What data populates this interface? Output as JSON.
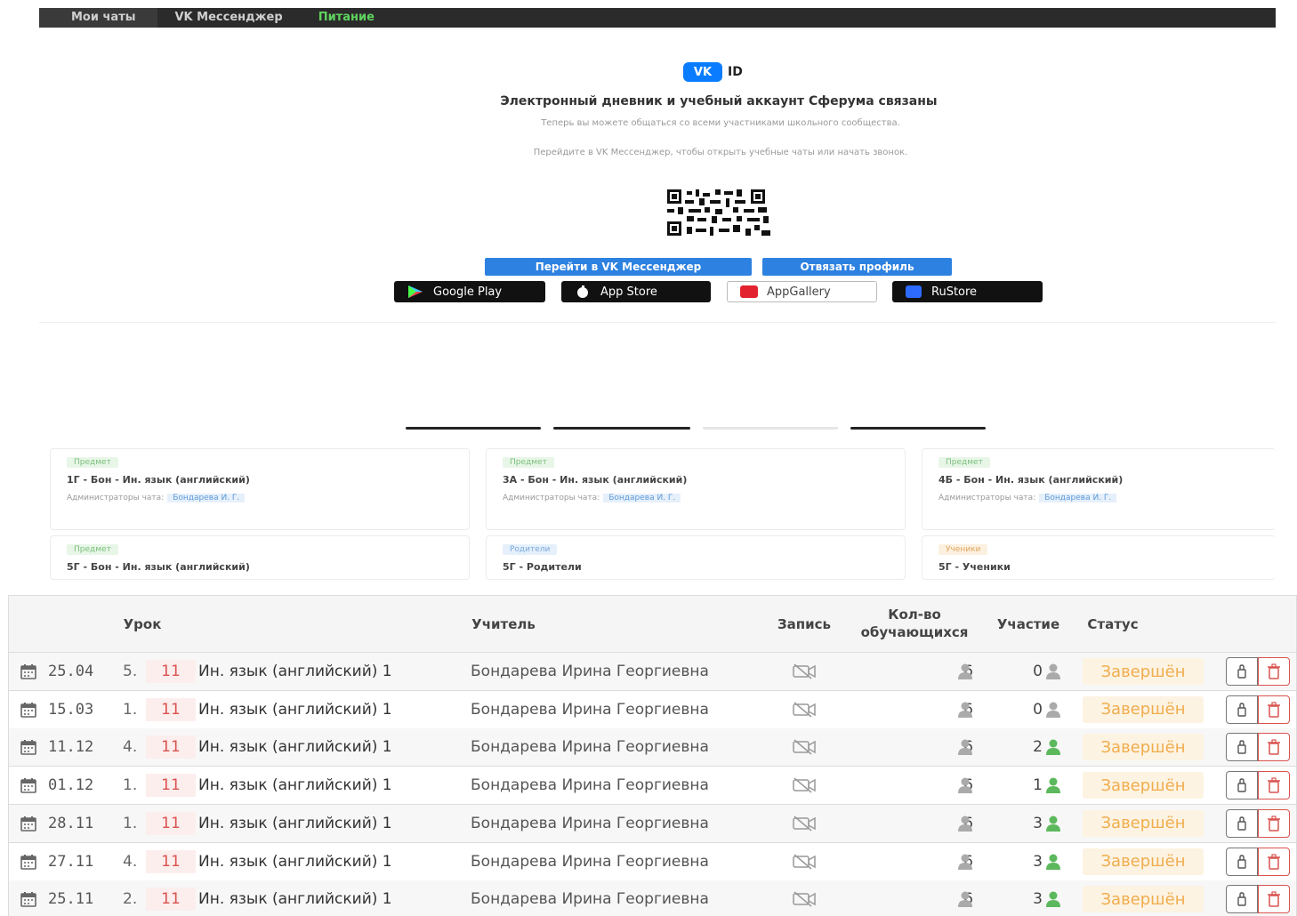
{
  "nav": {
    "items": [
      {
        "label": "Мои чаты"
      },
      {
        "label": "VK Мессенджер"
      },
      {
        "label": "Питание"
      }
    ]
  },
  "vk": {
    "badge": "VK",
    "id_label": "ID",
    "heading": "Электронный дневник и учебный аккаунт Сферума связаны",
    "sub1": "Теперь вы можете общаться со всеми участниками школьного сообщества.",
    "sub2": "Перейдите в VK Мессенджер, чтобы открыть учебные чаты или начать звонок.",
    "btn_go": "Перейти в VK Мессенджер",
    "btn_unlink": "Отвязать профиль",
    "stores": [
      {
        "label": "Google Play"
      },
      {
        "label": "App Store"
      },
      {
        "label": "AppGallery"
      },
      {
        "label": "RuStore"
      }
    ]
  },
  "chats": [
    {
      "tag": "Предмет",
      "title": "1Г - Бон - Ин. язык (английский)",
      "admin_label": "Администраторы чата:",
      "admin": "Бондарева И. Г."
    },
    {
      "tag": "Предмет",
      "title": "3А - Бон - Ин. язык (английский)",
      "admin_label": "Администраторы чата:",
      "admin": "Бондарева И. Г."
    },
    {
      "tag": "Предмет",
      "title": "4Б - Бон - Ин. язык (английский)",
      "admin_label": "Администраторы чата:",
      "admin": "Бондарева И. Г."
    },
    {
      "tag": "Предмет",
      "title": "5Г - Бон - Ин. язык (английский)"
    },
    {
      "tag": "Родители",
      "title": "5Г - Родители"
    },
    {
      "tag": "Ученики",
      "title": "5Г - Ученики"
    }
  ],
  "table": {
    "headers": {
      "lesson": "Урок",
      "teacher": "Учитель",
      "record": "Запись",
      "count_1": "Кол-во",
      "count_2": "обучающихся",
      "participation": "Участие",
      "status": "Статус"
    },
    "rows": [
      {
        "date": "25.04",
        "num": "5.",
        "grade": "11",
        "subject": "Ин. язык (английский) 1",
        "teacher": "Бондарева Ирина Георгиевна",
        "count": "6",
        "part": "0",
        "status": "Завершён"
      },
      {
        "date": "15.03",
        "num": "1.",
        "grade": "11",
        "subject": "Ин. язык (английский) 1",
        "teacher": "Бондарева Ирина Георгиевна",
        "count": "6",
        "part": "0",
        "status": "Завершён"
      },
      {
        "date": "11.12",
        "num": "4.",
        "grade": "11",
        "subject": "Ин. язык (английский) 1",
        "teacher": "Бондарева Ирина Георгиевна",
        "count": "6",
        "part": "2",
        "status": "Завершён"
      },
      {
        "date": "01.12",
        "num": "1.",
        "grade": "11",
        "subject": "Ин. язык (английский) 1",
        "teacher": "Бондарева Ирина Георгиевна",
        "count": "6",
        "part": "1",
        "status": "Завершён"
      },
      {
        "date": "28.11",
        "num": "1.",
        "grade": "11",
        "subject": "Ин. язык (английский) 1",
        "teacher": "Бондарева Ирина Георгиевна",
        "count": "6",
        "part": "3",
        "status": "Завершён"
      },
      {
        "date": "27.11",
        "num": "4.",
        "grade": "11",
        "subject": "Ин. язык (английский) 1",
        "teacher": "Бондарева Ирина Георгиевна",
        "count": "6",
        "part": "3",
        "status": "Завершён"
      },
      {
        "date": "25.11",
        "num": "2.",
        "grade": "11",
        "subject": "Ин. язык (английский) 1",
        "teacher": "Бондарева Ирина Георгиевна",
        "count": "6",
        "part": "3",
        "status": "Завершён"
      }
    ]
  },
  "colors": {
    "accent_green": "#5cb85c",
    "status_orange": "#f0ad4e",
    "delete_red": "#d9534f",
    "vk_blue": "#0a7cff"
  }
}
